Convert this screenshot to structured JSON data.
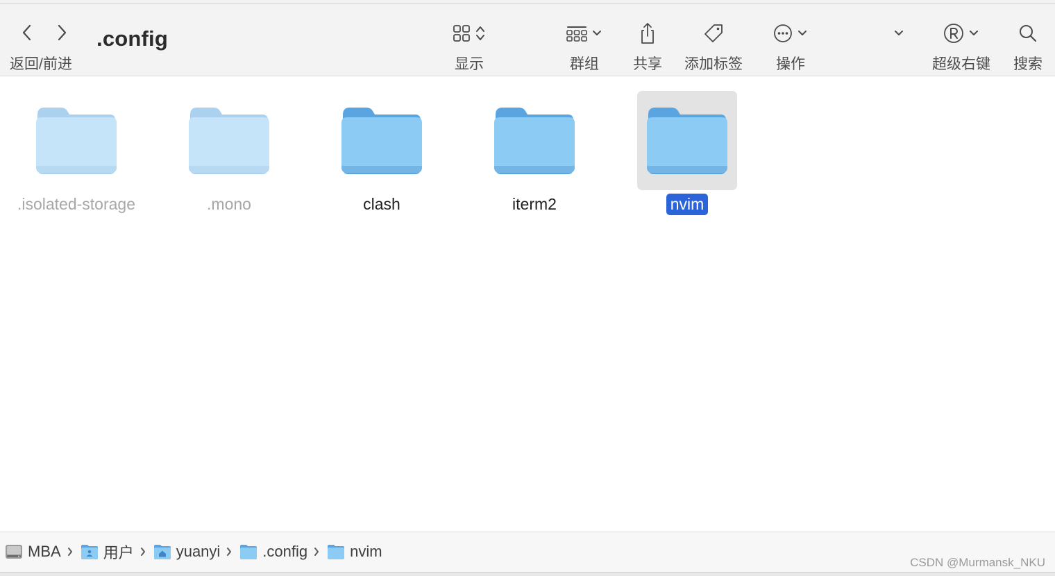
{
  "toolbar": {
    "nav_label": "返回/前进",
    "title": ".config",
    "view": {
      "label": "显示",
      "icon": "grid-view-icon"
    },
    "group": {
      "label": "群组",
      "icon": "group-icon"
    },
    "share": {
      "label": "共享",
      "icon": "share-icon"
    },
    "tags": {
      "label": "添加标签",
      "icon": "tag-icon"
    },
    "action": {
      "label": "操作",
      "icon": "ellipsis-circle-icon"
    },
    "super_right": {
      "label": "超级右键",
      "icon": "registered-icon"
    },
    "search": {
      "label": "搜索",
      "icon": "magnifier-icon"
    }
  },
  "files": [
    {
      "name": ".isolated-storage",
      "hidden": true,
      "selected": false
    },
    {
      "name": ".mono",
      "hidden": true,
      "selected": false
    },
    {
      "name": "clash",
      "hidden": false,
      "selected": false
    },
    {
      "name": "iterm2",
      "hidden": false,
      "selected": false
    },
    {
      "name": "nvim",
      "hidden": false,
      "selected": true
    }
  ],
  "pathbar": {
    "crumbs": [
      {
        "label": "MBA",
        "icon": "hard-drive-icon"
      },
      {
        "label": "用户",
        "icon": "users-folder-icon"
      },
      {
        "label": "yuanyi",
        "icon": "home-folder-icon"
      },
      {
        "label": ".config",
        "icon": "folder-icon"
      },
      {
        "label": "nvim",
        "icon": "folder-icon"
      }
    ]
  },
  "watermark": "CSDN @Murmansk_NKU",
  "colors": {
    "selection": "#2b63d9",
    "folder_front": "#8ccbf4",
    "folder_back": "#5aa4e0"
  }
}
